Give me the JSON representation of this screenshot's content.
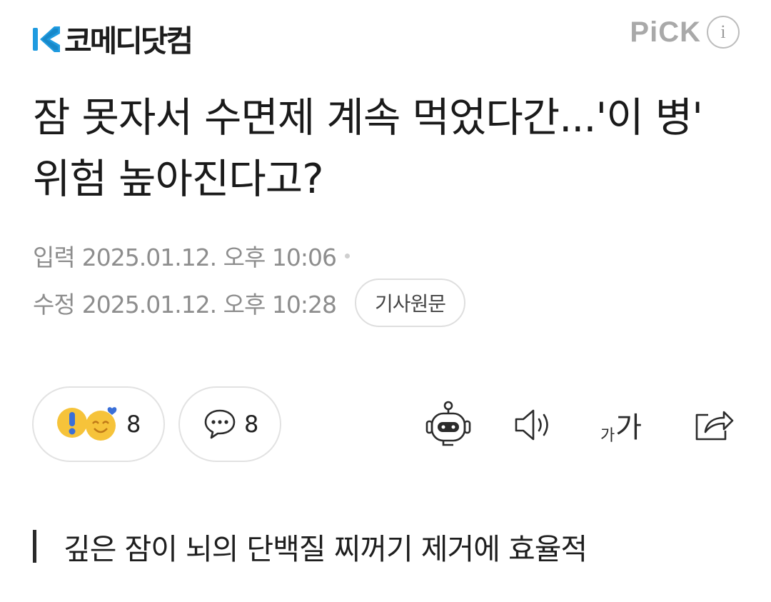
{
  "header": {
    "press_name": "코메디닷컴",
    "pick_label": "PiCK",
    "info_label": "i",
    "colors": {
      "logo_blue": "#1f9be0",
      "pick_gray": "#a9a9a9"
    }
  },
  "article": {
    "title": "잠 못자서 수면제 계속 먹었다간...'이 병' 위험 높아진다고?",
    "input_label": "입력",
    "input_datetime": "2025.01.12. 오후 10:06",
    "modified_label": "수정",
    "modified_datetime": "2025.01.12. 오후 10:28",
    "original_button": "기사원문",
    "subheadline": "깊은 잠이 뇌의 단백질 찌꺼기 제거에 효율적"
  },
  "actions": {
    "reaction_count": "8",
    "comment_count": "8",
    "font_small": "가",
    "font_large": "가",
    "icons": [
      "exclaim-emoji-icon",
      "smile-heart-emoji-icon",
      "speech-bubble-icon",
      "robot-summary-icon",
      "speaker-icon",
      "font-size-icon",
      "share-icon"
    ]
  }
}
